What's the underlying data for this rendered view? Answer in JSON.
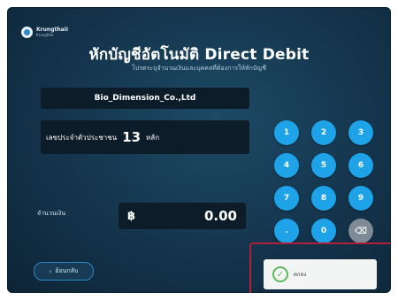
{
  "brand": {
    "name": "KrungthaiI",
    "sub": "Krungthai"
  },
  "header": {
    "title": "หักบัญชีอัตโนมัติ Direct Debit",
    "subtitle": "โปรดระบุจำนวนเงินและบุคคลที่ต้องการให้หักบัญชี"
  },
  "form": {
    "company": "Bio_Dimension_Co.,Ltd",
    "id_prompt": "เลขประจำตัวประชาชน",
    "id_digits": "13",
    "id_suffix": "หลัก",
    "amount_label": "จำนวนเงิน",
    "currency_symbol": "฿",
    "amount_value": "0.00"
  },
  "keypad": {
    "keys": [
      "1",
      "2",
      "3",
      "4",
      "5",
      "6",
      "7",
      "8",
      "9",
      ".",
      "0",
      "⌫"
    ]
  },
  "buttons": {
    "back_icon": "‹",
    "back_label": "ย้อนกลับ",
    "confirm_icon": "✓",
    "confirm_label": "ตกลง"
  },
  "colors": {
    "key_blue": "#1fa3e8",
    "highlight_red": "#b0203a",
    "confirm_green": "#5cb85c"
  }
}
